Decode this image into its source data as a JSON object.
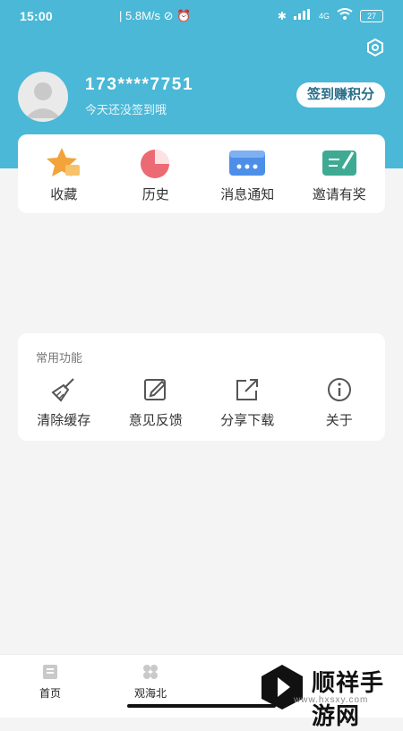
{
  "status_bar": {
    "time": "15:00",
    "speed": "5.8M/s",
    "network": "4G",
    "battery": "27"
  },
  "profile": {
    "phone": "173****7751",
    "subtitle": "今天还没签到哦",
    "checkin_label": "签到赚积分"
  },
  "quick_actions": [
    {
      "label": "收藏",
      "icon": "star-folder-icon"
    },
    {
      "label": "历史",
      "icon": "pie-history-icon"
    },
    {
      "label": "消息通知",
      "icon": "message-icon"
    },
    {
      "label": "邀请有奖",
      "icon": "invite-pen-icon"
    }
  ],
  "common": {
    "title": "常用功能",
    "items": [
      {
        "label": "清除缓存",
        "icon": "broom-icon"
      },
      {
        "label": "意见反馈",
        "icon": "edit-icon"
      },
      {
        "label": "分享下载",
        "icon": "share-icon"
      },
      {
        "label": "关于",
        "icon": "info-icon"
      }
    ]
  },
  "tabbar": [
    {
      "label": "首页",
      "icon": "home-icon"
    },
    {
      "label": "观海北",
      "icon": "grid-icon"
    }
  ],
  "watermark": {
    "brand": "顺祥手游网",
    "url": "www.hxsxy.com"
  },
  "colors": {
    "header": "#4ab8d6",
    "background": "#f4f4f4",
    "accent_text": "#2a6e8b"
  }
}
